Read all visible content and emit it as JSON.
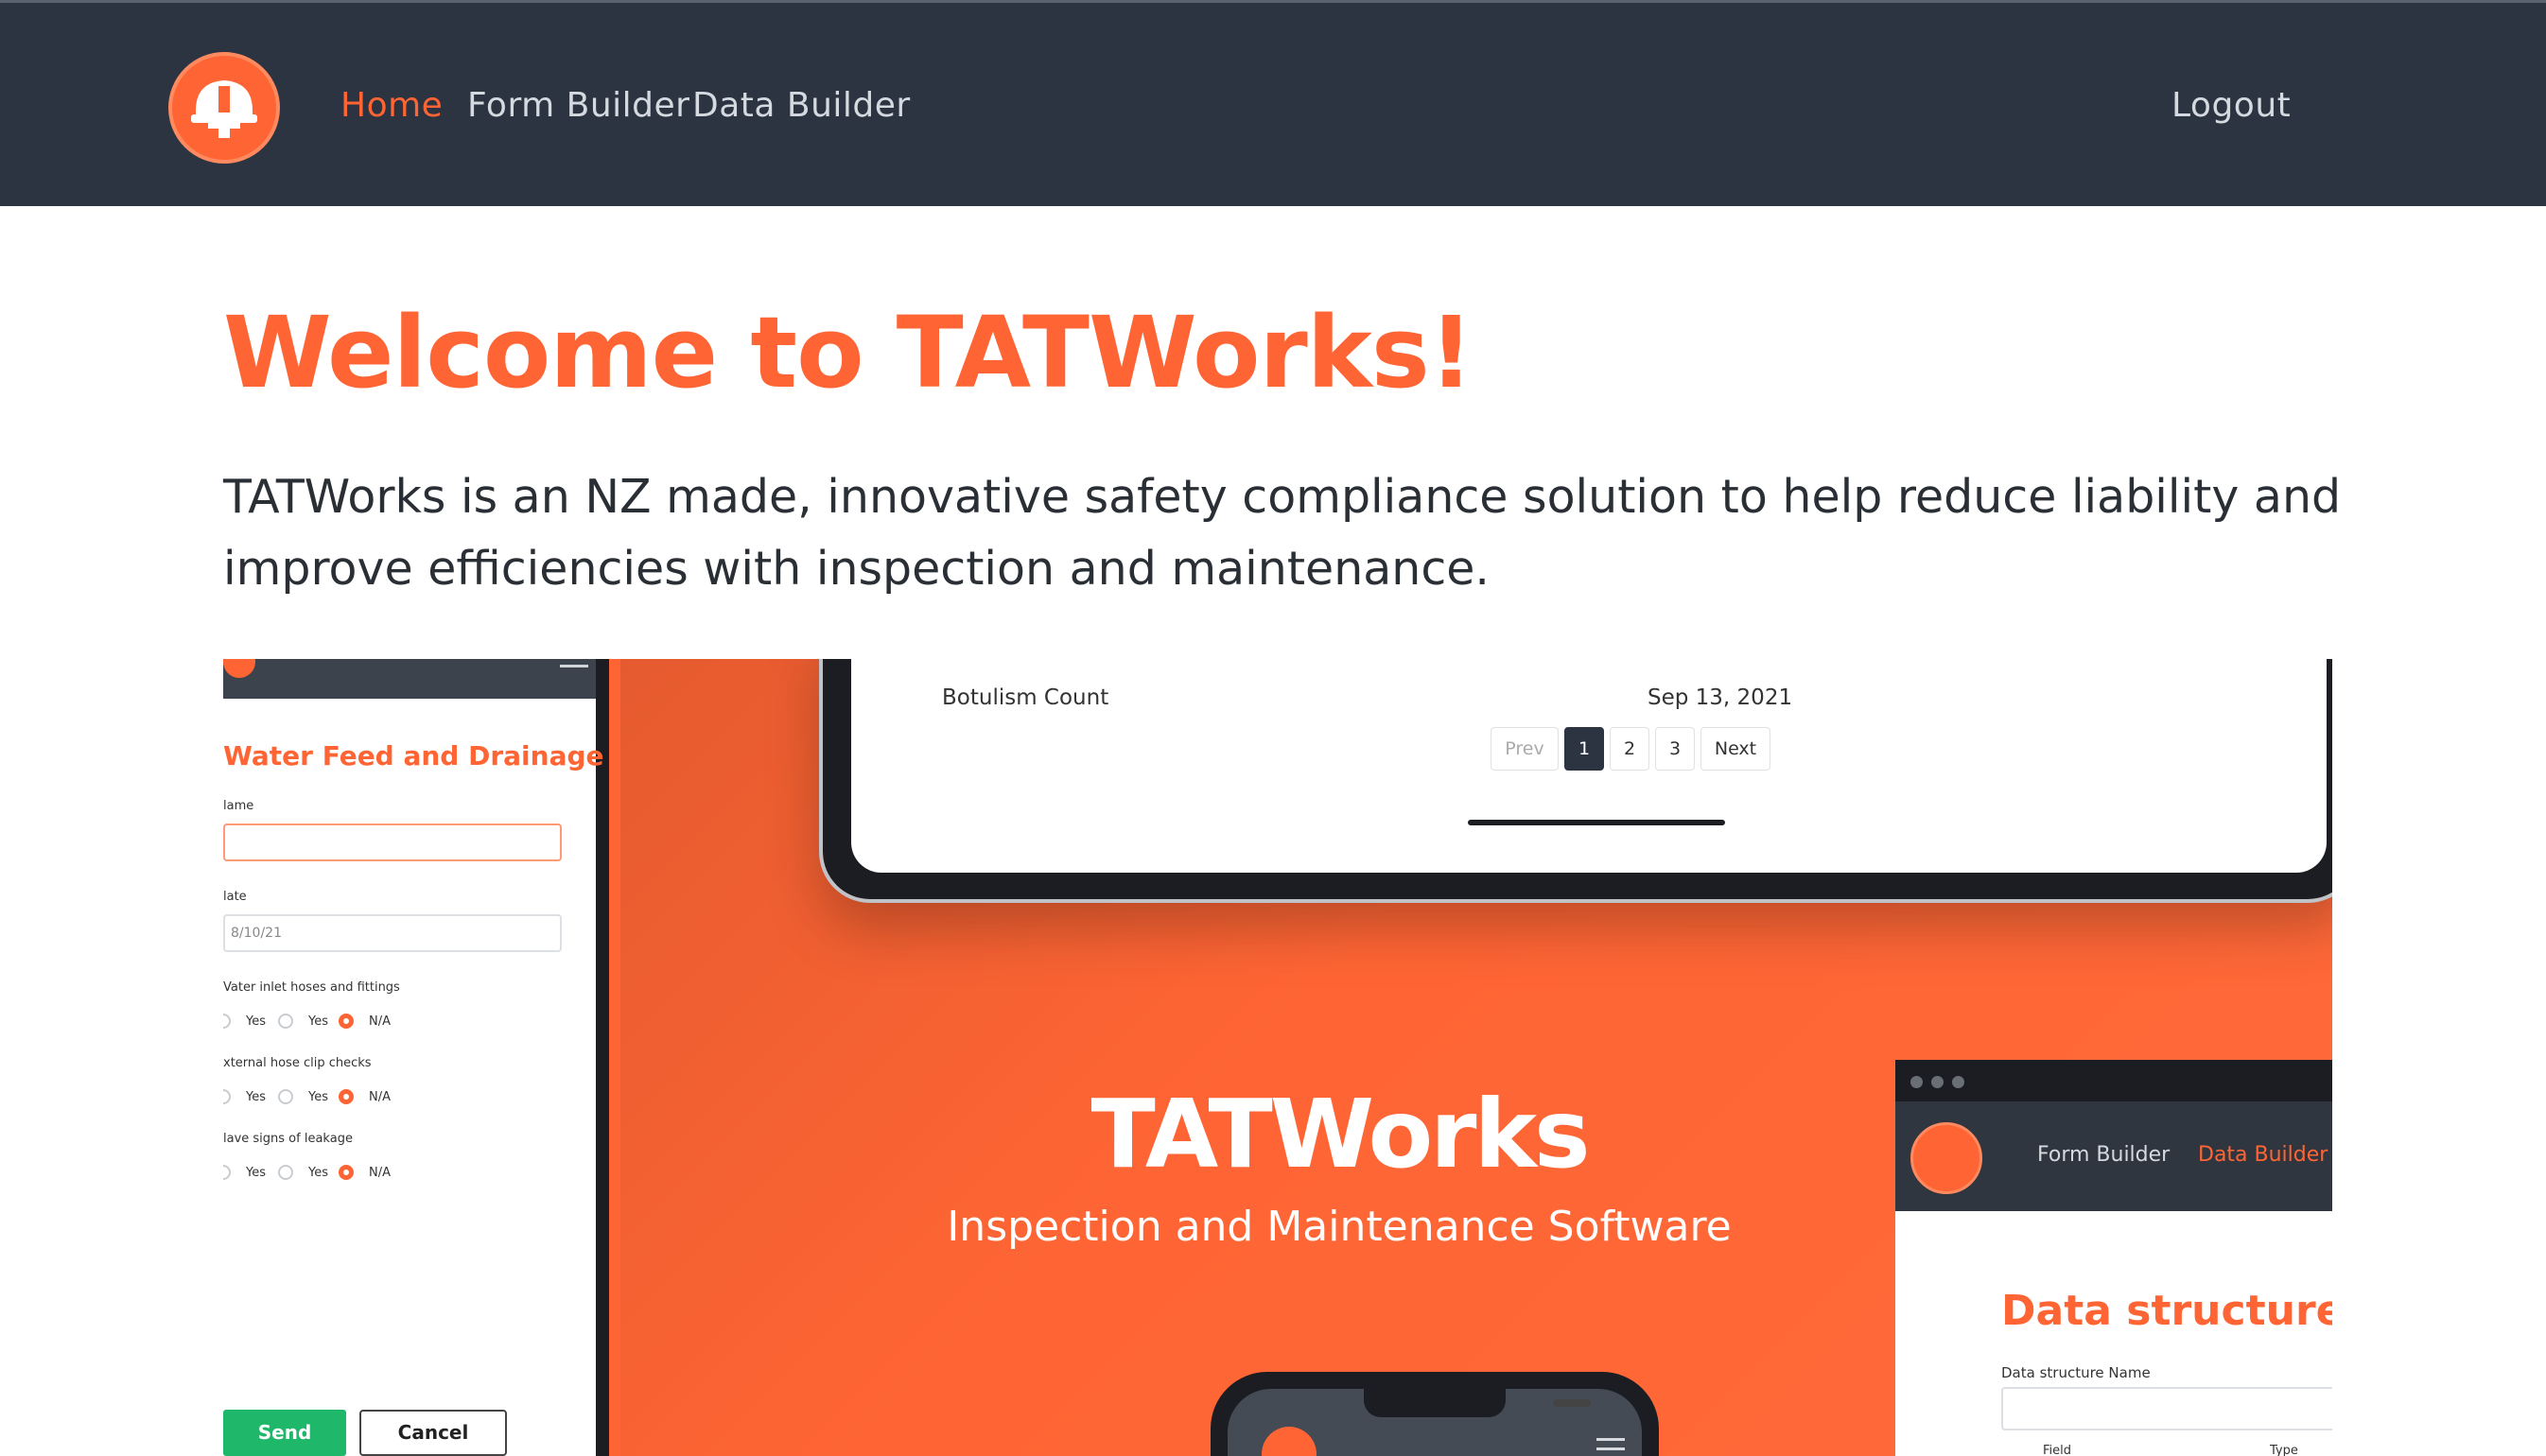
{
  "nav": {
    "logo_icon": "hard-hat-logo-icon",
    "links": [
      {
        "label": "Home",
        "active": true
      },
      {
        "label": "Form Builder",
        "active": false
      },
      {
        "label": "Data Builder",
        "active": false
      }
    ],
    "logout_label": "Logout"
  },
  "hero": {
    "title": "Welcome to TATWorks!",
    "description": "TATWorks is an NZ made, innovative safety compliance solution to help reduce liability and improve efficiencies with inspection and maintenance."
  },
  "showcase": {
    "brand_title": "TATWorks",
    "brand_subtitle": "Inspection and Maintenance Software",
    "phone_form": {
      "title": "Water Feed and Drainage",
      "name_label": "lame",
      "date_label": "late",
      "date_value": "8/10/21",
      "questions": [
        {
          "label": "Vater inlet hoses and fittings",
          "options": [
            "Yes",
            "Yes",
            "N/A"
          ],
          "selected": 2
        },
        {
          "label": "xternal hose clip checks",
          "options": [
            "Yes",
            "Yes",
            "N/A"
          ],
          "selected": 2
        },
        {
          "label": "lave signs of leakage",
          "options": [
            "Yes",
            "Yes",
            "N/A"
          ],
          "selected": 2
        }
      ],
      "send_label": "Send",
      "cancel_label": "Cancel"
    },
    "tablet": {
      "row_name": "Botulism Count",
      "row_date": "Sep 13, 2021",
      "pagination": [
        "Prev",
        "1",
        "2",
        "3",
        "Next"
      ],
      "active_page": "1"
    },
    "browser": {
      "links": [
        {
          "label": "Form Builder",
          "active": false
        },
        {
          "label": "Data Builder",
          "active": true
        }
      ],
      "title": "Data structure D",
      "field_label": "Data structure Name",
      "columns": [
        "Field",
        "Type"
      ]
    }
  },
  "colors": {
    "accent": "#ff6534",
    "navbar": "#2b3440",
    "success": "#1fb86a"
  }
}
